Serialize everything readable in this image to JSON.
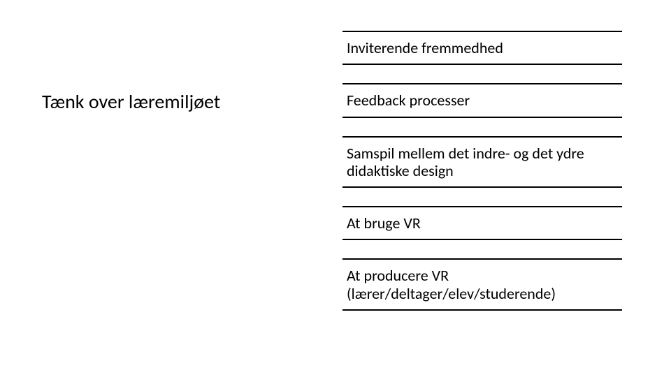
{
  "left_title": "Tænk over læremiljøet",
  "items": [
    "Inviterende fremmedhed",
    "Feedback processer",
    "Samspil mellem det indre- og det ydre didaktiske design",
    "At bruge VR",
    "At producere VR (lærer/deltager/elev/studerende)"
  ]
}
